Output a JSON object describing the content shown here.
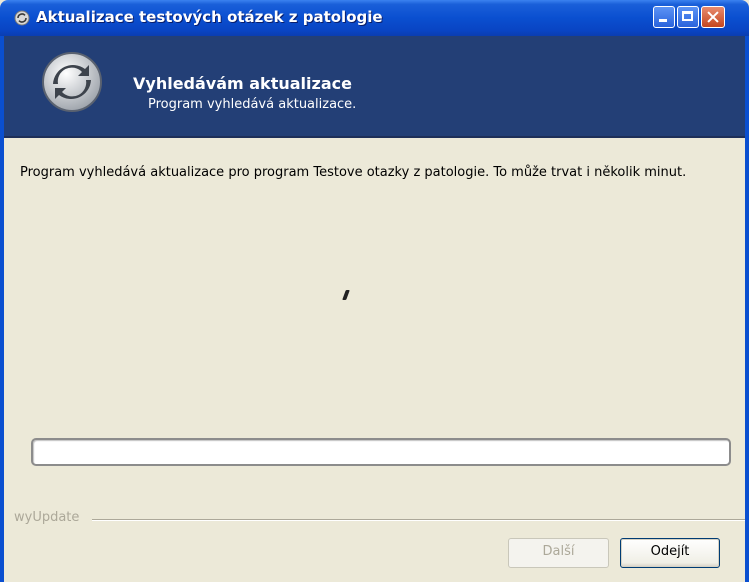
{
  "window": {
    "title": "Aktualizace testových otázek z patologie",
    "title_icon": "refresh-icon",
    "controls": {
      "minimize": "minimize-icon",
      "maximize": "maximize-icon",
      "close": "close-icon"
    }
  },
  "header": {
    "icon": "refresh-arrows-icon",
    "title": "Vyhledávám aktualizace",
    "subtitle": "Program vyhledává aktualizace."
  },
  "main": {
    "description": "Program vyhledává aktualizace pro program Testove otazky z patologie. To může trvat i několik minut.",
    "progress": 0
  },
  "footer": {
    "group_label": "wyUpdate",
    "next_label": "Další",
    "exit_label": "Odejít"
  },
  "colors": {
    "titlebar": "#0a4fd0",
    "header_bg": "#233f76",
    "window_bg": "#ece9d8"
  }
}
